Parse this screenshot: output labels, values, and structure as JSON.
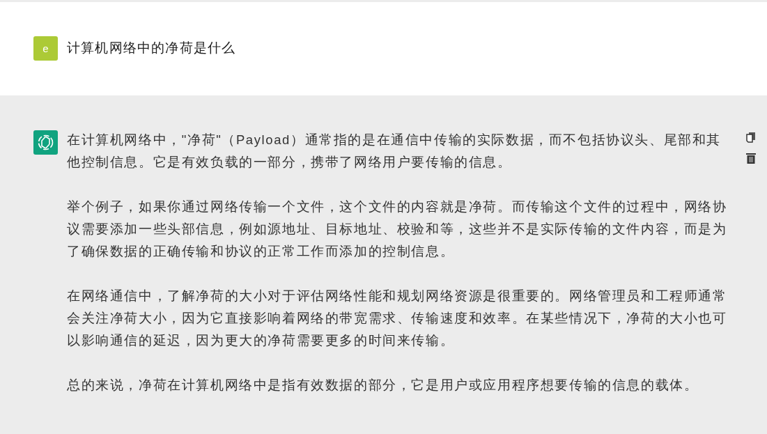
{
  "user_message": {
    "avatar_letter": "e",
    "text": "计算机网络中的净荷是什么"
  },
  "assistant_message": {
    "paragraphs": [
      "在计算机网络中，\"净荷\"（Payload）通常指的是在通信中传输的实际数据，而不包括协议头、尾部和其他控制信息。它是有效负载的一部分，携带了网络用户要传输的信息。",
      "举个例子，如果你通过网络传输一个文件，这个文件的内容就是净荷。而传输这个文件的过程中，网络协议需要添加一些头部信息，例如源地址、目标地址、校验和等，这些并不是实际传输的文件内容，而是为了确保数据的正确传输和协议的正常工作而添加的控制信息。",
      "在网络通信中，了解净荷的大小对于评估网络性能和规划网络资源是很重要的。网络管理员和工程师通常会关注净荷大小，因为它直接影响着网络的带宽需求、传输速度和效率。在某些情况下，净荷的大小也可以影响通信的延迟，因为更大的净荷需要更多的时间来传输。",
      "总的来说，净荷在计算机网络中是指有效数据的部分，它是用户或应用程序想要传输的信息的载体。"
    ]
  }
}
